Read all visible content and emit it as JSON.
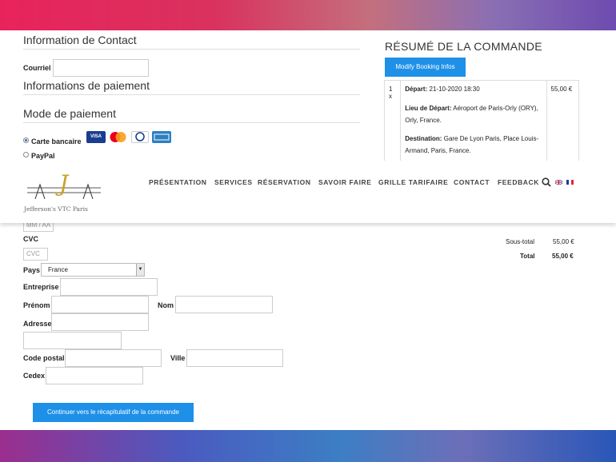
{
  "contact": {
    "title": "Information de Contact",
    "email_label": "Courriel"
  },
  "payment": {
    "info_title": "Informations de paiement",
    "mode_title": "Mode de paiement",
    "card_label": "Carte bancaire",
    "paypal_label": "PayPal",
    "cards": [
      "VISA",
      "Mastercard",
      "Diners Club",
      "American Express"
    ],
    "expiry_placeholder": "MM / AA",
    "cvc_label": "CVC",
    "cvc_placeholder": "CVC"
  },
  "form": {
    "country_label": "Pays",
    "country_value": "France",
    "company_label": "Entreprise",
    "firstname_label": "Prénom",
    "lastname_label": "Nom",
    "address_label": "Adresse",
    "postcode_label": "Code postal",
    "city_label": "Ville",
    "cedex_label": "Cedex",
    "submit_label": "Continuer vers le récapitulatif de la commande"
  },
  "summary": {
    "title": "RÉSUMÉ DE LA COMMANDE",
    "modify_label": "Modify Booking Infos",
    "qty": "1 x",
    "depart_label": "Départ:",
    "depart_value": "21-10-2020 18:30",
    "price": "55,00 €",
    "pickup_label": "Lieu de Départ:",
    "pickup_value": "Aéroport de Paris-Orly (ORY), Orly, France.",
    "dest_label": "Destination:",
    "dest_value": "Gare De Lyon Paris, Place Louis-Armand, Paris, France.",
    "subtotal_label": "Sous-total",
    "subtotal_value": "55,00 €",
    "total_label": "Total",
    "total_value": "55,00 €"
  },
  "header": {
    "logo_text": "Jefferson's VTC Paris",
    "nav": [
      "PRÉSENTATION",
      "SERVICES",
      "RÉSERVATION",
      "SAVOIR FAIRE",
      "GRILLE TARIFAIRE",
      "CONTACT",
      "FEEDBACK"
    ]
  },
  "colors": {
    "accent": "#1e90e8",
    "logo_gold": "#c9a227"
  }
}
